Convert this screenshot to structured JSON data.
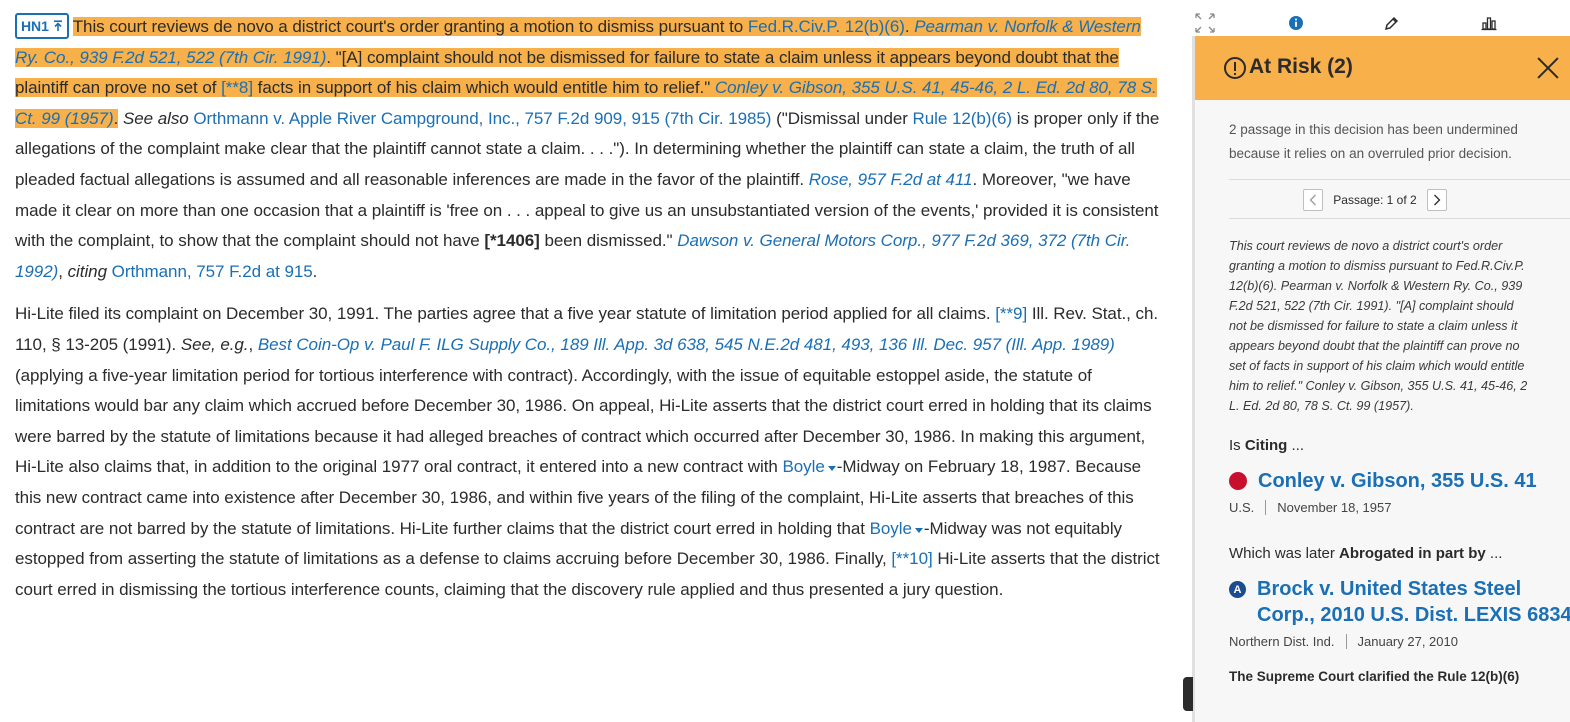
{
  "doc": {
    "hn_label": "HN1",
    "p1": {
      "s1": "This court reviews de novo a district court's order granting a motion to dismiss pursuant to ",
      "c1": "Fed.R.Civ.P. 12(b)(6)",
      "s2": ". ",
      "c2": "Pearman v. Norfolk & Western Ry. Co., 939 F.2d 521, 522 (7th Cir. 1991)",
      "s3": ". \"[A] complaint should not be dismissed for failure to state a claim unless it appears beyond doubt that the plaintiff can prove no set of ",
      "pg1": "[**8]",
      "s4": " facts in support of his claim which would entitle him to relief.\" ",
      "c3": "Conley v. Gibson, 355 U.S. 41, 45-46, 2 L. Ed. 2d 80, 78 S. Ct. 99 (1957)",
      "s5": ".",
      "s6": " See also ",
      "c4": "Orthmann v. Apple River Campground, Inc., 757 F.2d 909, 915 (7th Cir. 1985)",
      "s7": " (\"Dismissal under ",
      "c5": "Rule 12(b)(6)",
      "s8": " is proper only if the allegations of the complaint make clear that the plaintiff cannot state a claim. . . .\"). In determining whether the plaintiff can state a claim, the truth of all pleaded factual allegations is assumed and all reasonable inferences are made in the favor of the plaintiff. ",
      "c6": "Rose, 957 F.2d at 411",
      "s9": ". Moreover, \"we have made it clear on more than one occasion that a plaintiff is 'free on . . . appeal to give us an unsubstantiated version of the events,' provided it is consistent with the complaint, to show that the complaint should not have ",
      "pg2": "[*1406]",
      "s10": " been dismissed.\" ",
      "c7": "Dawson v. General Motors Corp., 977 F.2d 369, 372 (7th Cir. 1992)",
      "s11": ", ",
      "s12": "citing",
      "s13": " ",
      "c8": "Orthmann, 757 F.2d at 915",
      "s14": "."
    },
    "p2": {
      "s1": "Hi-Lite filed its complaint on December 30, 1991. The parties agree that a five year statute of limitation period applied for all claims. ",
      "pg1": "[**9]",
      "s2": " Ill. Rev. Stat., ch. 110, § 13-205 (1991). ",
      "s3": "See, e.g.",
      "s4": ", ",
      "c1": "Best Coin-Op v. Paul F. ILG Supply Co., 189 Ill. App. 3d 638, 545 N.E.2d 481, 493, 136 Ill. Dec. 957 (Ill. App. 1989)",
      "s5": " (applying a five-year limitation period for tortious interference with contract). Accordingly, with the issue of equitable estoppel aside, the statute of limitations would bar any claim which accrued before December 30, 1986. On appeal, Hi-Lite asserts that the district court erred in holding that its claims were barred by the statute of limitations because it had alleged breaches of contract which occurred after December 30, 1986. In making this argument, Hi-Lite also claims that, in addition to the original 1977 oral contract, it entered into a new contract with ",
      "boyle1": "Boyle",
      "s6": "-Midway on February 18, 1987. Because this new contract came into existence after December 30, 1986, and within five years of the filing of the complaint, Hi-Lite asserts that breaches of this contract are not barred by the statute of limitations. Hi-Lite further claims that the district court erred in holding that ",
      "boyle2": "Boyle",
      "s7": "-Midway was not equitably estopped from asserting the statute of limitations as a defense to claims accruing before December 30, 1986. Finally, ",
      "pg2": "[**10]",
      "s8": " Hi-Lite asserts that the district court erred in dismissing the tortious interference counts, claiming that the discovery rule applied and thus presented a jury question."
    }
  },
  "toolbar": {
    "icons": [
      "expand-icon",
      "info-icon",
      "pencil-icon",
      "chart-icon"
    ]
  },
  "panel": {
    "title": "At Risk (2)",
    "description": "2 passage in this decision has been undermined because it relies on an overruled prior decision.",
    "pager_text": "Passage: 1 of 2",
    "passage": "This court reviews de novo a district court's order granting a motion to dismiss pursuant to Fed.R.Civ.P. 12(b)(6). Pearman v. Norfolk & Western Ry. Co., 939 F.2d 521, 522 (7th Cir. 1991). \"[A] complaint should not be dismissed for failure to state a claim unless it appears beyond doubt that the plaintiff can prove no set of facts in support of his claim which would entitle him to relief.\" Conley v. Gibson, 355 U.S. 41, 45-46, 2 L. Ed. 2d 80, 78 S. Ct. 99 (1957).",
    "citing_pre": "Is ",
    "citing_bold": "Citing",
    "citing_post": " ...",
    "case1": {
      "title": "Conley v. Gibson, 355 U.S. 41",
      "court": "U.S.",
      "date": "November 18, 1957"
    },
    "later_pre": "Which was later ",
    "later_bold": "Abrogated in part by",
    "later_post": " ...",
    "case2": {
      "badge": "A",
      "title": "Brock v. United States Steel Corp., 2010 U.S. Dist. LEXIS 6834",
      "court": "Northern Dist. Ind.",
      "date": "January 27, 2010"
    },
    "note": "The Supreme Court clarified the Rule 12(b)(6)"
  },
  "colors": {
    "highlight": "#f7b04a",
    "link": "#1a6fb5",
    "red": "#c8102e",
    "badge": "#1a4d8f"
  }
}
